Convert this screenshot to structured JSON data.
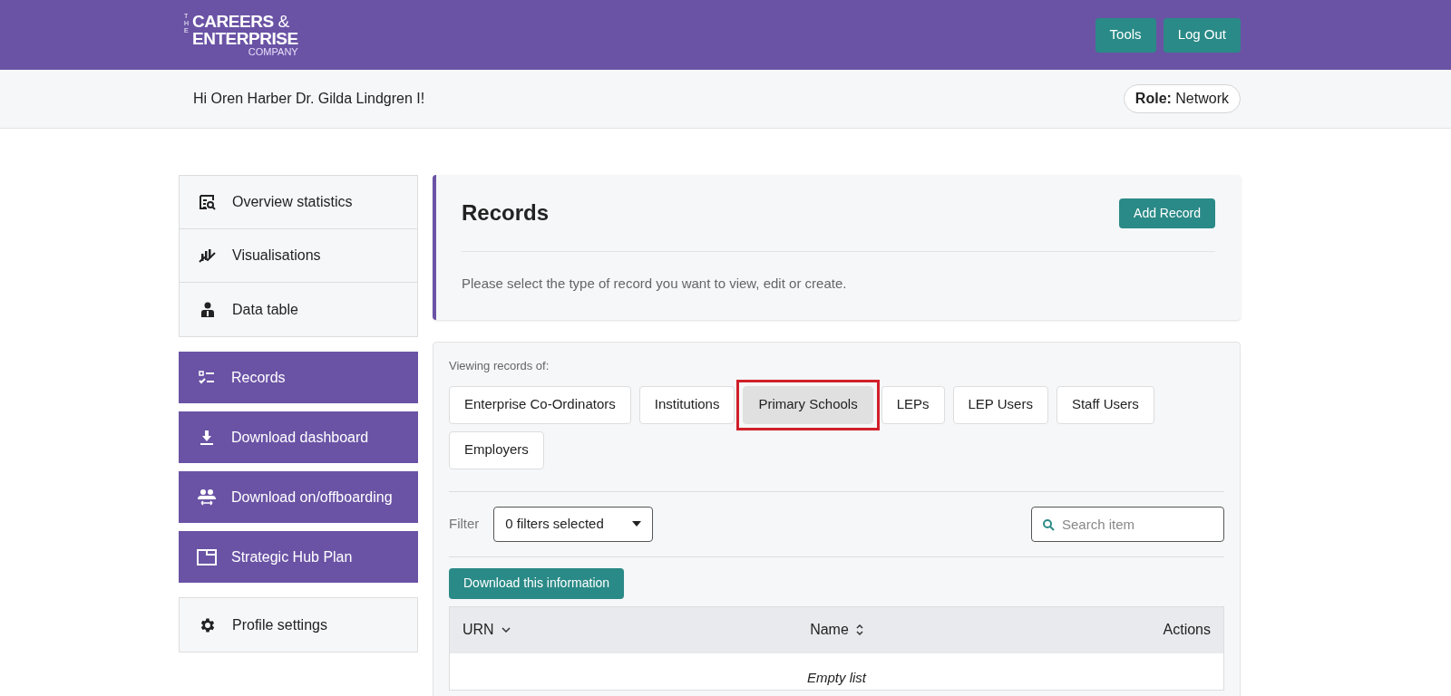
{
  "header": {
    "logo": {
      "small": "THE",
      "line1": "CAREERS",
      "amp": "&",
      "line2": "ENTERPRISE",
      "line3": "COMPANY"
    },
    "buttons": [
      "Tools",
      "Log Out"
    ]
  },
  "greeting": {
    "text": "Hi Oren Harber Dr. Gilda Lindgren I!",
    "role_label": "Role:",
    "role_value": "Network"
  },
  "sidebar": {
    "groups": [
      {
        "kind": "plain",
        "items": [
          {
            "label": "Overview statistics"
          },
          {
            "label": "Visualisations"
          },
          {
            "label": "Data table"
          }
        ]
      },
      {
        "kind": "accent",
        "items": [
          {
            "label": "Records"
          },
          {
            "label": "Download dashboard"
          },
          {
            "label": "Download on/offboarding"
          },
          {
            "label": "Strategic Hub Plan"
          }
        ]
      },
      {
        "kind": "plain",
        "items": [
          {
            "label": "Profile settings"
          }
        ]
      }
    ]
  },
  "records_header": {
    "title": "Records",
    "button": "Add Record",
    "description": "Please select the type of record you want to view, edit or create."
  },
  "records": {
    "viewing_label": "Viewing records of:",
    "types": [
      {
        "label": "Enterprise Co-Ordinators",
        "selected": false,
        "highlighted": false
      },
      {
        "label": "Institutions",
        "selected": false,
        "highlighted": false
      },
      {
        "label": "Primary Schools",
        "selected": true,
        "highlighted": true
      },
      {
        "label": "LEPs",
        "selected": false,
        "highlighted": false
      },
      {
        "label": "LEP Users",
        "selected": false,
        "highlighted": false
      },
      {
        "label": "Staff Users",
        "selected": false,
        "highlighted": false
      },
      {
        "label": "Employers",
        "selected": false,
        "highlighted": false
      }
    ],
    "filter_label": "Filter",
    "filter_value": "0 filters selected",
    "search": {
      "placeholder": "Search item"
    },
    "download_button": "Download this information",
    "table": {
      "columns": [
        {
          "label": "URN",
          "kind": "dropdown"
        },
        {
          "label": "Name",
          "kind": "sortable"
        },
        {
          "label": "Actions",
          "kind": "plain"
        }
      ],
      "empty_text": "Empty list"
    }
  }
}
